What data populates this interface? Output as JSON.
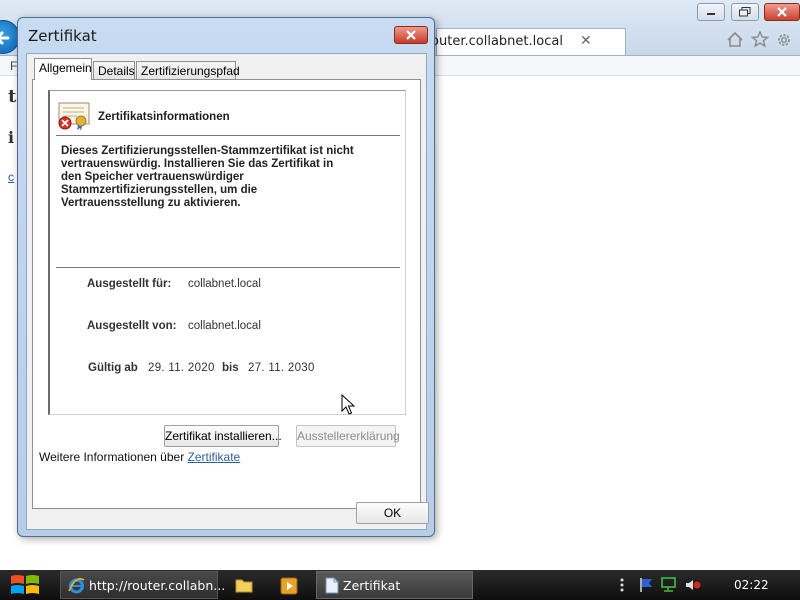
{
  "browser": {
    "tab_title": "router.collabnet.local",
    "menu_fragment": "F",
    "page_fragment_1": "ti",
    "page_fragment_2": "i",
    "page_fragment_3": "c"
  },
  "dialog": {
    "title": "Zertifikat",
    "tabs": [
      "Allgemein",
      "Details",
      "Zertifizierungspfad"
    ],
    "heading": "Zertifikatsinformationen",
    "warning_lines": [
      "Dieses Zertifizierungsstellen-Stammzertifikat ist nicht",
      "vertrauenswürdig. Installieren Sie das Zertifikat in",
      "den Speicher vertrauenswürdiger",
      "Stammzertifizierungsstellen, um die",
      "Vertrauensstellung zu aktivieren."
    ],
    "issued_to_label": "Ausgestellt für:",
    "issued_to_value": "collabnet.local",
    "issued_by_label": "Ausgestellt von:",
    "issued_by_value": "collabnet.local",
    "valid_from_label": "Gültig ab",
    "valid_from_value": "29. 11. 2020",
    "valid_to_label": "bis",
    "valid_to_value": "27. 11. 2030",
    "install_button": "Zertifikat installieren...",
    "issuer_statement_button": "Ausstellererklärung",
    "more_info_text": "Weitere Informationen über ",
    "more_info_link": "Zertifikate",
    "ok_button": "OK"
  },
  "taskbar": {
    "ie_label": "http://router.collabn...",
    "cert_label": "Zertifikat",
    "clock": "02:22"
  },
  "icons": {
    "back": "back-arrow-icon",
    "home": "home-icon",
    "favorites": "star-icon",
    "tools": "gear-icon",
    "certificate": "certificate-error-icon",
    "start": "windows-logo-icon",
    "tray": [
      "show-hidden-icons-icon",
      "action-center-flag-icon",
      "network-icon",
      "volume-muted-icon"
    ]
  },
  "colors": {
    "dialog_frame": "#c7dbf1",
    "link": "#2c5ea3",
    "close_button": "#c43c27",
    "taskbar": "#1a1a1a"
  }
}
